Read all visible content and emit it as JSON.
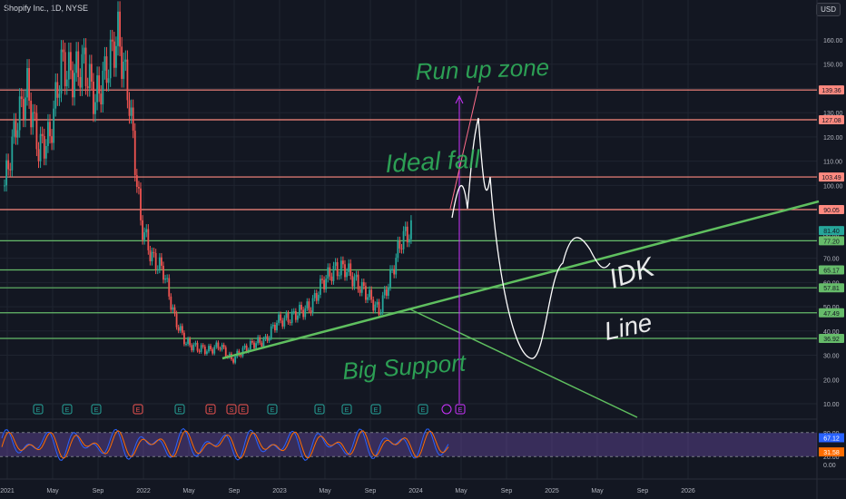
{
  "header": {
    "title": "Shopify Inc., 1D, NYSE",
    "currency": "USD"
  },
  "colors": {
    "background": "#131722",
    "up": "#26a69a",
    "down": "#ef5350",
    "support_level": "#ff8a80",
    "resistance_level": "#66bb6a",
    "trendline": "#5fbf5f",
    "handwriting": "#2fae5a",
    "projection": "#ffffff",
    "marker": "#cc33ff",
    "stoch_k": "#2962ff",
    "stoch_d": "#ff6d00",
    "stoch_band": "#7e57c2"
  },
  "chart_data": {
    "type": "line",
    "ylim": [
      0,
      170
    ],
    "y_ticks": [
      0.0,
      10.0,
      20.0,
      30.0,
      40.0,
      50.0,
      60.0,
      70.0,
      80.0,
      90.0,
      100.0,
      110.0,
      120.0,
      130.0,
      140.0,
      150.0,
      160.0
    ],
    "x_ticks": [
      "2021",
      "May",
      "Sep",
      "2022",
      "May",
      "Sep",
      "2023",
      "May",
      "Sep",
      "2024",
      "May",
      "Sep",
      "2025",
      "May",
      "Sep",
      "2026"
    ],
    "price_series": {
      "name": "SHOP close",
      "x": [
        "2021-01",
        "2021-02",
        "2021-03",
        "2021-04",
        "2021-05",
        "2021-06",
        "2021-07",
        "2021-08",
        "2021-09",
        "2021-10",
        "2021-11",
        "2021-12",
        "2022-01",
        "2022-02",
        "2022-03",
        "2022-04",
        "2022-05",
        "2022-06",
        "2022-07",
        "2022-08",
        "2022-09",
        "2022-10",
        "2022-11",
        "2022-12",
        "2023-01",
        "2023-02",
        "2023-03",
        "2023-04",
        "2023-05",
        "2023-06",
        "2023-07",
        "2023-08",
        "2023-09",
        "2023-10",
        "2023-11",
        "2023-12",
        "2024-01"
      ],
      "values": [
        100,
        125,
        140,
        115,
        120,
        150,
        145,
        150,
        135,
        148,
        162,
        135,
        85,
        70,
        65,
        45,
        35,
        33,
        32,
        34,
        28,
        32,
        35,
        36,
        44,
        45,
        48,
        50,
        60,
        65,
        66,
        60,
        55,
        48,
        62,
        78,
        82
      ]
    },
    "horizontal_levels": [
      {
        "label": "139.36",
        "value": 139.36,
        "kind": "resistance"
      },
      {
        "label": "127.08",
        "value": 127.08,
        "kind": "resistance"
      },
      {
        "label": "103.49",
        "value": 103.49,
        "kind": "resistance"
      },
      {
        "label": "90.05",
        "value": 90.05,
        "kind": "resistance"
      },
      {
        "label": "77.20",
        "value": 77.2,
        "kind": "support"
      },
      {
        "label": "65.17",
        "value": 65.17,
        "kind": "support"
      },
      {
        "label": "57.81",
        "value": 57.81,
        "kind": "support"
      },
      {
        "label": "47.49",
        "value": 47.49,
        "kind": "support"
      },
      {
        "label": "36.92",
        "value": 36.92,
        "kind": "support"
      }
    ],
    "extra_price_label": "81.40",
    "annotations": [
      "Run up zone",
      "Ideal fall",
      "Big Support",
      "IDK",
      "Line"
    ],
    "earnings_markers": [
      "E",
      "E",
      "E",
      "E",
      "E",
      "E",
      "S",
      "E",
      "E",
      "E",
      "E",
      "E",
      "E"
    ],
    "stochastic": {
      "labels": [
        "80.00",
        "20.00",
        "0.00"
      ],
      "k_value": "67.12",
      "d_value": "31.58",
      "band": [
        20,
        80
      ],
      "ylim": [
        0,
        100
      ]
    }
  }
}
